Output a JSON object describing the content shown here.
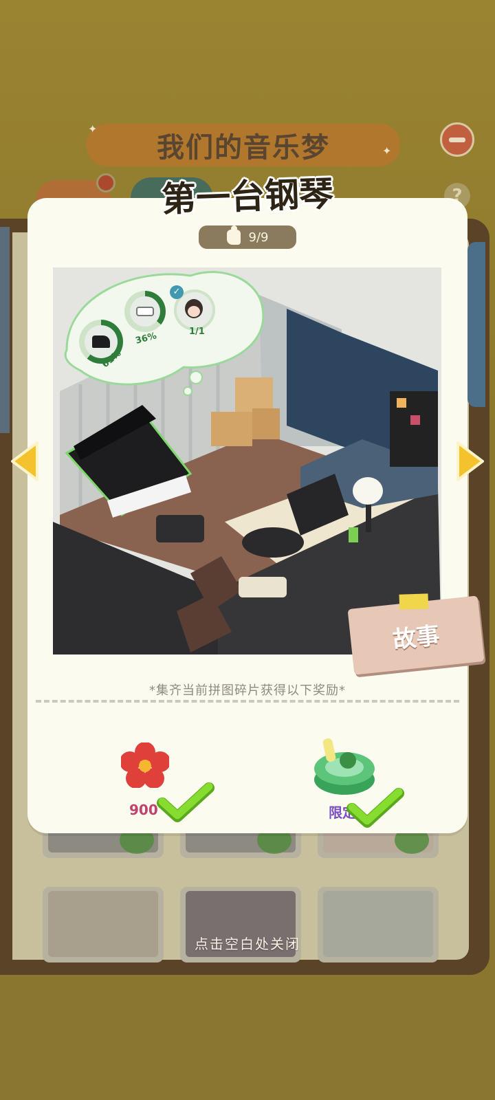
{
  "header": {
    "album_title": "我们的音乐梦",
    "puzzle_title": "第一台钢琴",
    "help_symbol": "?"
  },
  "progress": {
    "label": "9/9",
    "collected": 9,
    "total": 9
  },
  "scene": {
    "tasks": [
      {
        "icon": "piano-icon",
        "percent": "61%",
        "value": 0.61
      },
      {
        "icon": "paint-roller-icon",
        "percent": "36%",
        "value": 0.36
      },
      {
        "icon": "character-icon",
        "percent": "1/1",
        "done": true
      }
    ]
  },
  "story_button": {
    "label": "故事"
  },
  "rewards": {
    "caption": "*集齐当前拼图碎片获得以下奖励*",
    "items": [
      {
        "icon": "red-flower-icon",
        "label": "900",
        "claimed": true,
        "label_color": "#c0426f"
      },
      {
        "icon": "green-cushion-seat-icon",
        "label": "限定",
        "claimed": true,
        "label_color": "#7b4dc2"
      }
    ]
  },
  "close_hint": "点击空白处关闭",
  "colors": {
    "card_bg": "#fbfcef",
    "accent_green": "#7dcf2b",
    "arrow_yellow": "#f4c22c",
    "pill_bg": "#8a7a5e"
  }
}
